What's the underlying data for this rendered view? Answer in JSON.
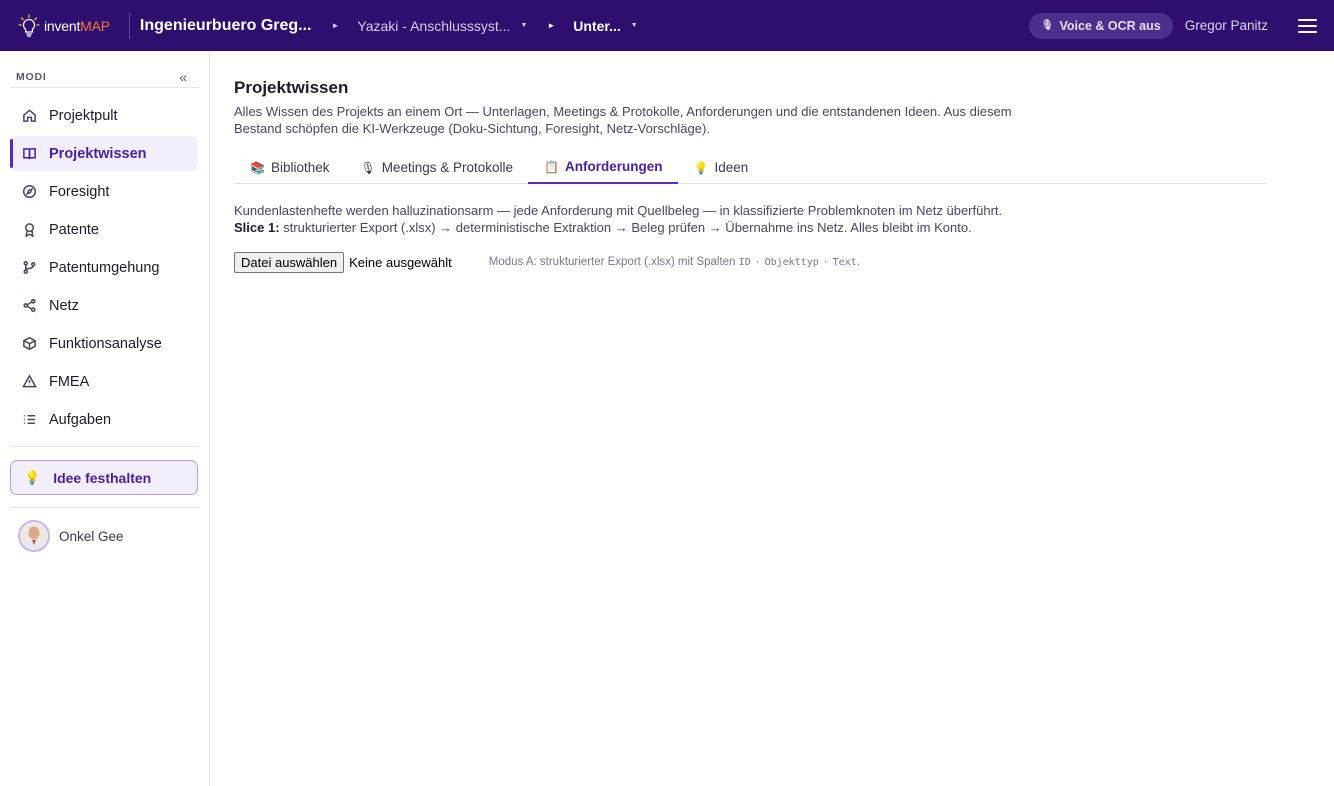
{
  "topbar": {
    "logo_part1": "invent",
    "logo_part2": "MAP",
    "organization": "Ingenieurbuero Greg...",
    "breadcrumbs": [
      {
        "label": "Yazaki - Anschlusssyst...",
        "current": false
      },
      {
        "label": "Unter...",
        "current": true
      }
    ],
    "voice_button": "Voice & OCR aus",
    "user_name": "Gregor Panitz"
  },
  "sidebar": {
    "section_label": "MODI",
    "collapse_glyph": "«",
    "items": [
      {
        "label": "Projektpult",
        "icon": "home-icon"
      },
      {
        "label": "Projektwissen",
        "icon": "book-icon",
        "active": true
      },
      {
        "label": "Foresight",
        "icon": "compass-icon"
      },
      {
        "label": "Patente",
        "icon": "award-icon"
      },
      {
        "label": "Patentumgehung",
        "icon": "branch-icon"
      },
      {
        "label": "Netz",
        "icon": "share-icon"
      },
      {
        "label": "Funktionsanalyse",
        "icon": "cube-icon"
      },
      {
        "label": "FMEA",
        "icon": "warning-icon"
      },
      {
        "label": "Aufgaben",
        "icon": "list-icon"
      }
    ],
    "idea_button": "Idee festhalten",
    "profile_name": "Onkel Gee"
  },
  "main": {
    "title": "Projektwissen",
    "description": "Alles Wissen des Projekts an einem Ort — Unterlagen, Meetings & Protokolle, Anforderungen und die entstandenen Ideen. Aus diesem Bestand schöpfen die KI-Werkzeuge (Doku-Sichtung, Foresight, Netz-Vorschläge).",
    "tabs": [
      {
        "label": "Bibliothek",
        "icon": "📚"
      },
      {
        "label": "Meetings & Protokolle",
        "icon": "🎙"
      },
      {
        "label": "Anforderungen",
        "icon": "📋",
        "active": true
      },
      {
        "label": "Ideen",
        "icon": "💡"
      }
    ],
    "requirements": {
      "intro": "Kundenlastenhefte werden halluzinationsarm — jede Anforderung mit Quellbeleg — in klassifizierte Problemknoten im Netz überführt.",
      "slice_label": "Slice 1:",
      "slice_text": "strukturierter Export (.xlsx) → deterministische Extraktion → Beleg prüfen → Übernahme ins Netz. Alles bleibt im Konto.",
      "file_button": "Datei auswählen",
      "file_status": "Keine ausgewählt",
      "mode_hint_prefix": "Modus A: strukturierter Export (.xlsx) mit Spalten",
      "columns": [
        "ID",
        "Objekttyp",
        "Text"
      ],
      "mode_hint_suffix": "."
    }
  }
}
